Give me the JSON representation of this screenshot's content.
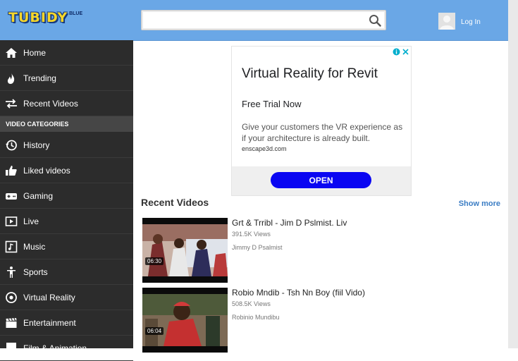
{
  "header": {
    "logo_main": "TUBIDY",
    "logo_sub": "BLUE",
    "search_value": "",
    "login_label": "Log In"
  },
  "sidebar": {
    "items": [
      {
        "label": "Home",
        "icon": "home-icon"
      },
      {
        "label": "Trending",
        "icon": "flame-icon"
      },
      {
        "label": "Recent Videos",
        "icon": "swap-arrows-icon"
      }
    ],
    "section_label": "VIDEO CATEGORIES",
    "categories": [
      {
        "label": "History",
        "icon": "history-icon"
      },
      {
        "label": "Liked videos",
        "icon": "thumbs-up-icon"
      },
      {
        "label": "Gaming",
        "icon": "gamepad-icon"
      },
      {
        "label": "Live",
        "icon": "live-icon"
      },
      {
        "label": "Music",
        "icon": "music-icon"
      },
      {
        "label": "Sports",
        "icon": "person-icon"
      },
      {
        "label": "Virtual Reality",
        "icon": "target-icon"
      },
      {
        "label": "Entertainment",
        "icon": "clapperboard-icon"
      },
      {
        "label": "Film & Animation",
        "icon": "film-icon"
      }
    ]
  },
  "ad": {
    "title": "Virtual Reality for Revit",
    "subtitle": "Free Trial Now",
    "description": "Give your customers the VR experience as if your architecture is already built.",
    "domain": "enscape3d.com",
    "cta": "OPEN",
    "cta_color": "#0a06f2"
  },
  "recent": {
    "title": "Recent Videos",
    "show_more": "Show more",
    "videos": [
      {
        "title": "Grt & Trribl - Jim D Pslmist. Liv",
        "views": "391.5K Views",
        "channel": "Jimmy D Psalmist",
        "duration": "06:30"
      },
      {
        "title": "Robio Mndib - Tsh Nn Boy (fiil Vido)",
        "views": "508.5K Views",
        "channel": "Robinio Mundibu",
        "duration": "06:04"
      }
    ]
  },
  "colors": {
    "header_bg": "#6aa7e6",
    "sidebar_bg": "#2c2c2c",
    "link": "#3b7dc4"
  }
}
